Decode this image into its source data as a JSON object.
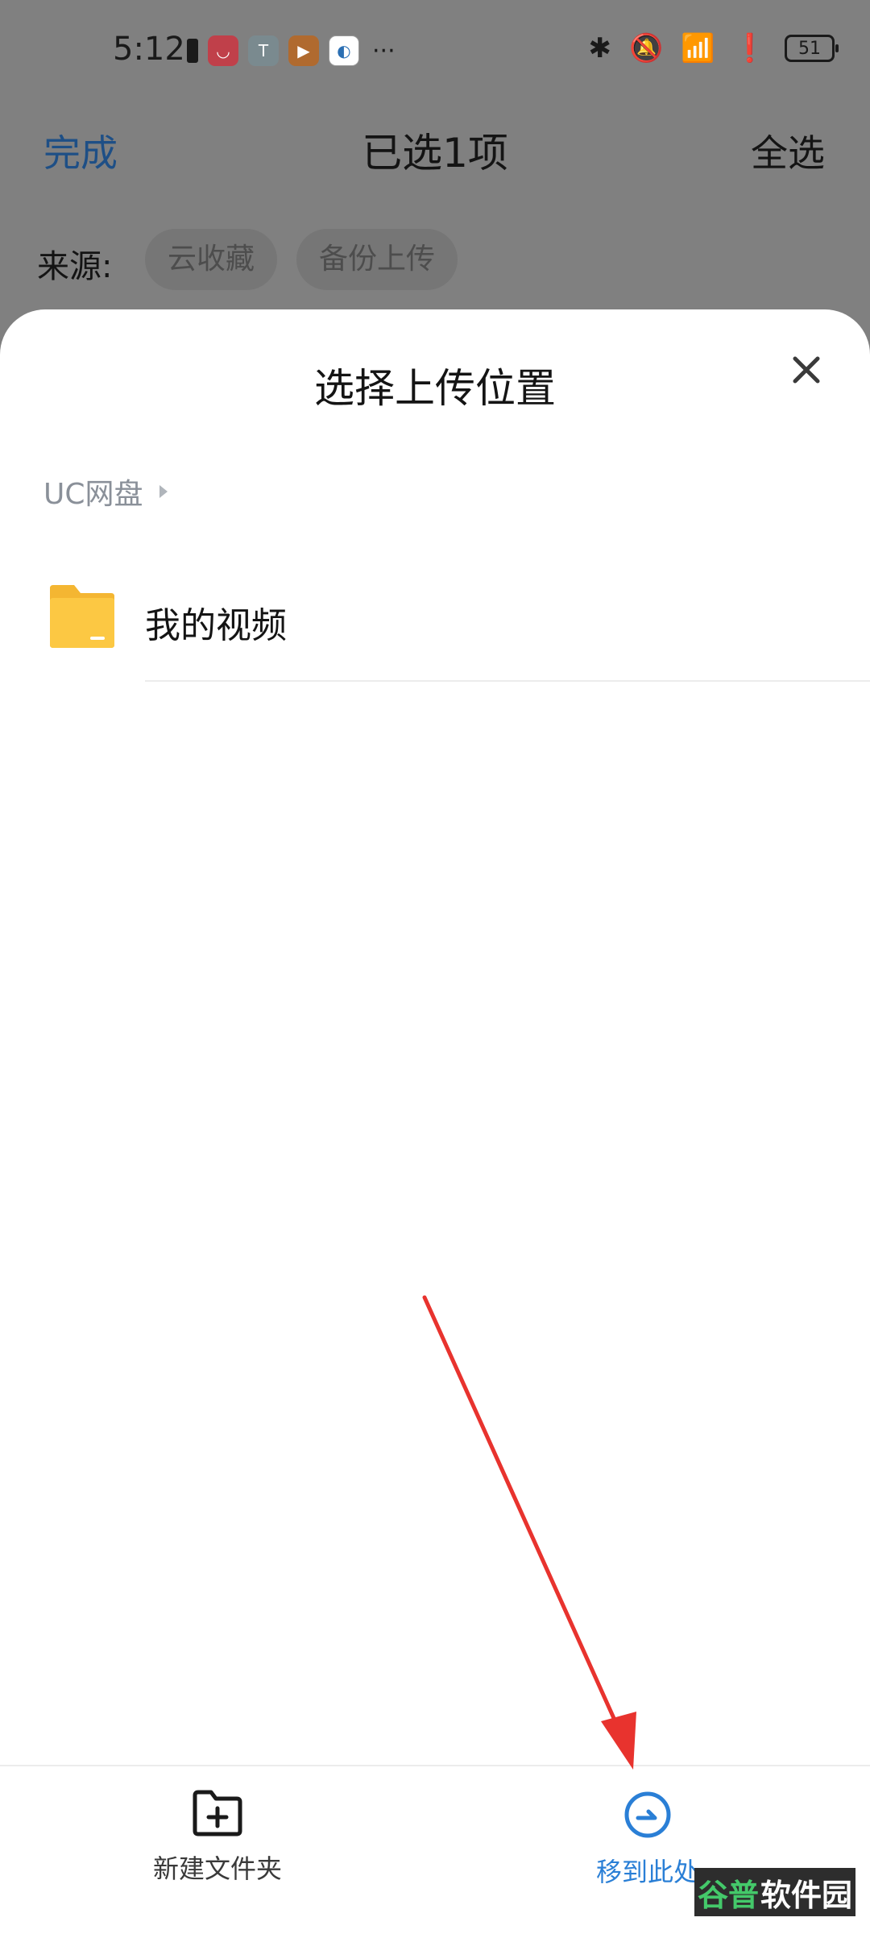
{
  "status_bar": {
    "time": "5:12",
    "battery_level": "51",
    "left_icons": [
      "battery-alert-icon",
      "huawei-appgallery-icon",
      "paint-app-icon",
      "video-app-icon",
      "browser-app-icon"
    ],
    "more": "···",
    "right_icons": [
      "bluetooth-icon",
      "mute-bell-icon",
      "wifi-icon",
      "alert-icon",
      "battery-icon"
    ]
  },
  "topbar": {
    "done_label": "完成",
    "title": "已选1项",
    "select_all_label": "全选",
    "done_color": "#1e4f86"
  },
  "source": {
    "label": "来源:",
    "chips": [
      "云收藏",
      "备份上传"
    ]
  },
  "sheet": {
    "title": "选择上传位置",
    "breadcrumb": "UC网盘",
    "folders": [
      {
        "name": "我的视频",
        "icon": "folder-icon"
      }
    ]
  },
  "bottom_bar": {
    "new_folder_label": "新建文件夹",
    "move_here_label": "移到此处",
    "accent_color": "#2a7fd6"
  },
  "watermark": {
    "part_a": "谷普",
    "part_b": "软件园"
  }
}
